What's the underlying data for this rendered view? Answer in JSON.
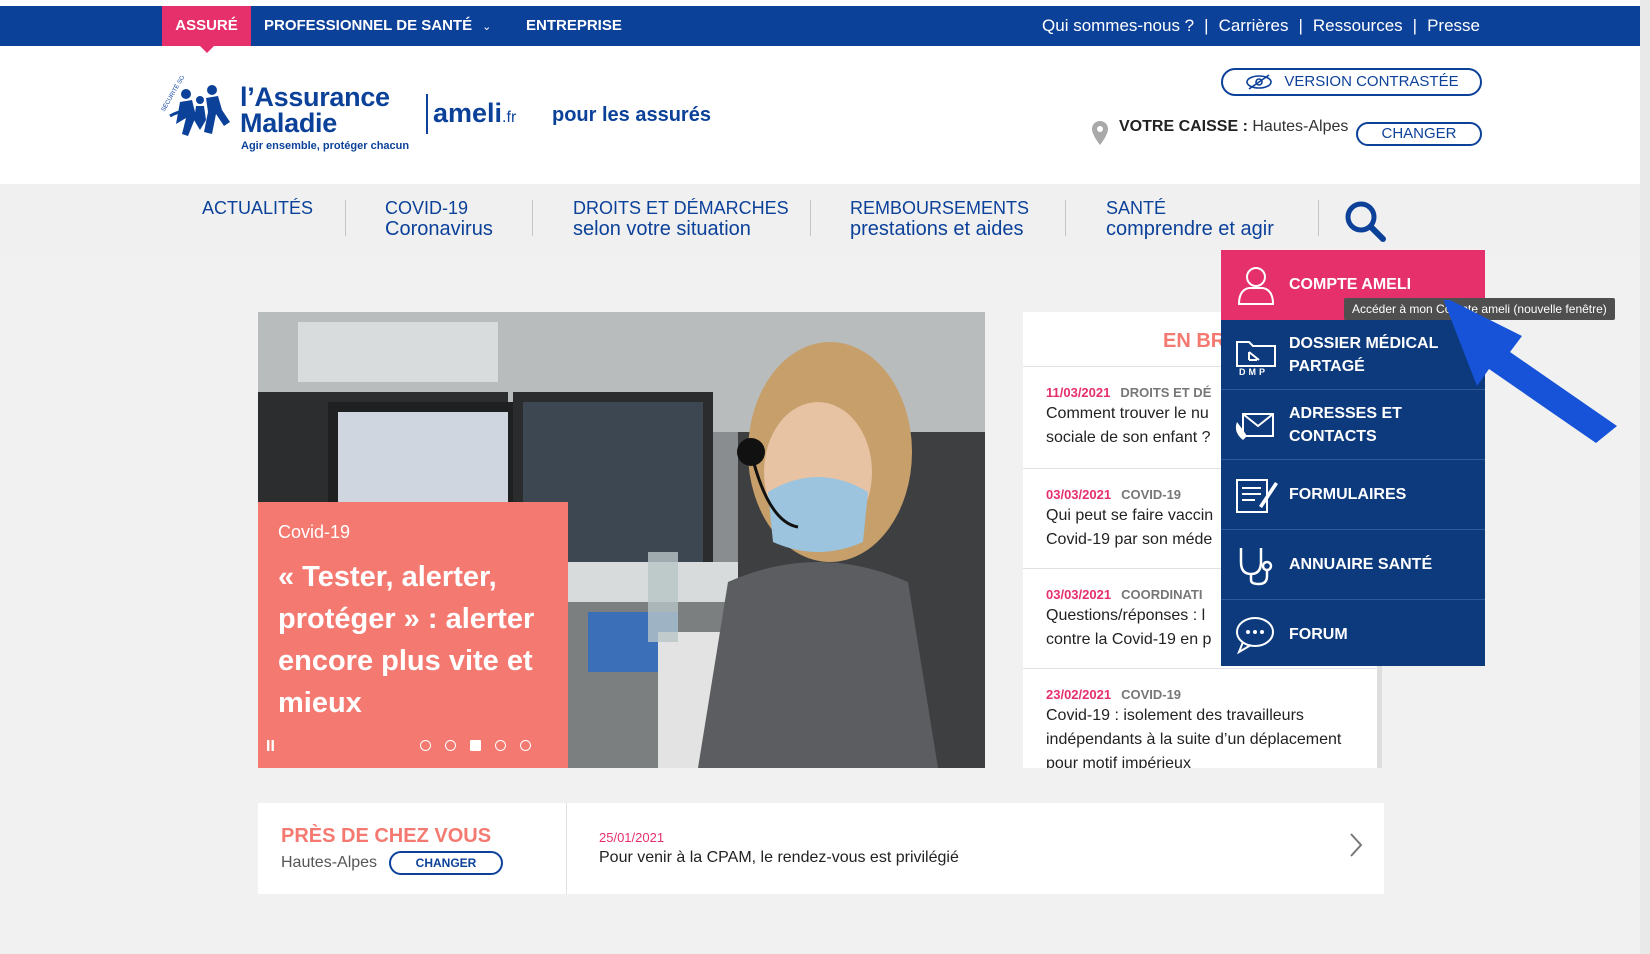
{
  "topbar": {
    "tabs": [
      {
        "label": "ASSURÉ",
        "active": true
      },
      {
        "label": "PROFESSIONNEL DE SANTÉ",
        "has_dropdown": true
      },
      {
        "label": "ENTREPRISE"
      }
    ],
    "links": [
      "Qui sommes-nous ?",
      "Carrières",
      "Ressources",
      "Presse"
    ],
    "separator": "|"
  },
  "header": {
    "logo": {
      "name_line1": "l’Assurance",
      "name_line2": "Maladie",
      "tagline": "Agir ensemble, protéger chacun",
      "seal_text": "SÉCURITÉ SOCIALE"
    },
    "brand": {
      "name": "ameli",
      "suffix": ".fr"
    },
    "audience": "pour les assurés",
    "contrast_button": "VERSION CONTRASTÉE",
    "caisse_label": "VOTRE CAISSE :",
    "caisse_value": "Hautes-Alpes",
    "changer_button": "CHANGER"
  },
  "nav": {
    "items": [
      {
        "line1": "ACTUALITÉS",
        "line2": ""
      },
      {
        "line1": "COVID-19",
        "line2": "Coronavirus"
      },
      {
        "line1": "DROITS ET DÉMARCHES",
        "line2": "selon votre situation"
      },
      {
        "line1": "REMBOURSEMENTS",
        "line2": "prestations et aides"
      },
      {
        "line1": "SANTÉ",
        "line2": "comprendre et agir"
      }
    ],
    "search_icon": "search-icon"
  },
  "hero": {
    "tag": "Covid-19",
    "title": "« Tester, alerter, protéger » : alerter encore plus vite et mieux",
    "pause": "II",
    "slides_total": 5,
    "active_slide": 3
  },
  "en_bref": {
    "title": "EN BR",
    "items": [
      {
        "date": "11/03/2021",
        "category": "DROITS ET DÉ",
        "text": "Comment trouver le nu sociale de son enfant ?"
      },
      {
        "date": "03/03/2021",
        "category": "COVID-19",
        "text": "Qui peut se faire vaccin Covid-19 par son méde"
      },
      {
        "date": "03/03/2021",
        "category": "COORDINATI",
        "text": "Questions/réponses : l contre la Covid-19 en p"
      },
      {
        "date": "23/02/2021",
        "category": "COVID-19",
        "text": "Covid-19 : isolement des travailleurs indépendants à la suite d’un déplacement pour motif impérieux"
      }
    ]
  },
  "compte_menu": {
    "items": [
      {
        "label": "COMPTE AMELI",
        "icon": "user-icon"
      },
      {
        "label": "DOSSIER MÉDICAL PARTAGÉ",
        "icon": "dmp-folder-icon",
        "icon_text": "DMP"
      },
      {
        "label": "ADRESSES ET CONTACTS",
        "icon": "phone-mail-icon"
      },
      {
        "label": "FORMULAIRES",
        "icon": "form-icon"
      },
      {
        "label": "ANNUAIRE SANTÉ",
        "icon": "stethoscope-icon"
      },
      {
        "label": "FORUM",
        "icon": "chat-icon"
      }
    ],
    "tooltip": "Accéder à mon Compte ameli (nouvelle fenêtre)"
  },
  "pres": {
    "title": "PRÈS DE CHEZ VOUS",
    "location": "Hautes-Alpes",
    "button": "CHANGER",
    "date": "25/01/2021",
    "text": "Pour venir à la CPAM, le rendez-vous est privilégié"
  },
  "colors": {
    "brand_blue": "#0c419a",
    "pink": "#e5306c",
    "salmon": "#f47a71",
    "menu_navy": "#0c3a7d",
    "annotation_arrow": "#1753d9"
  }
}
